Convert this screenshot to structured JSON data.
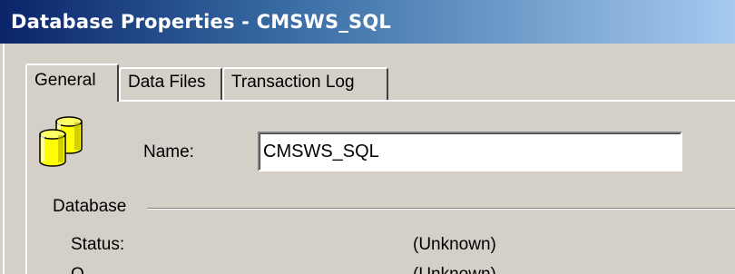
{
  "window": {
    "title": "Database Properties - CMSWS_SQL"
  },
  "tabs": [
    {
      "label": "General",
      "active": true
    },
    {
      "label": "Data Files",
      "active": false
    },
    {
      "label": "Transaction Log",
      "active": false
    }
  ],
  "general": {
    "icon": "database-icon",
    "name_label": "Name:",
    "name_value": "CMSWS_SQL",
    "database_group": {
      "title": "Database",
      "rows": [
        {
          "label": "Status:",
          "value": "(Unknown)"
        },
        {
          "label": "O...",
          "value": "(Unknown)"
        }
      ]
    }
  },
  "colors": {
    "title_start": "#0a246a",
    "title_end": "#a6caf0",
    "dialog_face": "#d4d0c8",
    "icon_yellow": "#ffff00"
  }
}
